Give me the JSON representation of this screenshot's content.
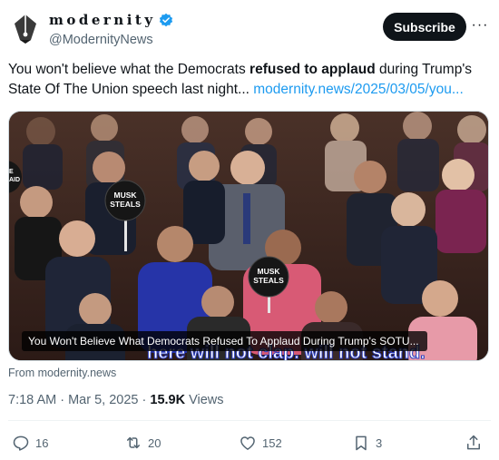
{
  "account": {
    "display_name": "modernity",
    "handle": "@ModernityNews",
    "avatar_icon": "pen-nib-logo-icon",
    "verified_icon": "verified-badge-icon",
    "verified_color": "#1d9bf0"
  },
  "header": {
    "subscribe_label": "Subscribe",
    "more_icon": "more-options-icon",
    "more_label": "···"
  },
  "tweet": {
    "text_before": "You won't believe what the Democrats ",
    "text_bold": "refused to applaud",
    "text_after": " during Trump's State Of The Union speech last night... ",
    "link": "modernity.news/2025/03/05/you..."
  },
  "media": {
    "caption": "You Won't Believe What Democrats Refused To Applaud During Trump's SOTU...",
    "sign_text_1_line1": "MUSK",
    "sign_text_1_line2": "STEALS",
    "sign_text_2_line1": "MUSK",
    "sign_text_2_line2": "STEALS",
    "sign_edge_line1": "E",
    "sign_edge_line2": "AID",
    "subtitle_text": "here will not clap. will not stand."
  },
  "source": "From modernity.news",
  "meta": {
    "time": "7:18 AM",
    "separator": " · ",
    "date": "Mar 5, 2025",
    "views_count": "15.9K",
    "views_label": " Views"
  },
  "actions": {
    "reply_count": "16",
    "repost_count": "20",
    "like_count": "152",
    "bookmark_count": "3",
    "accent": "#536471"
  }
}
